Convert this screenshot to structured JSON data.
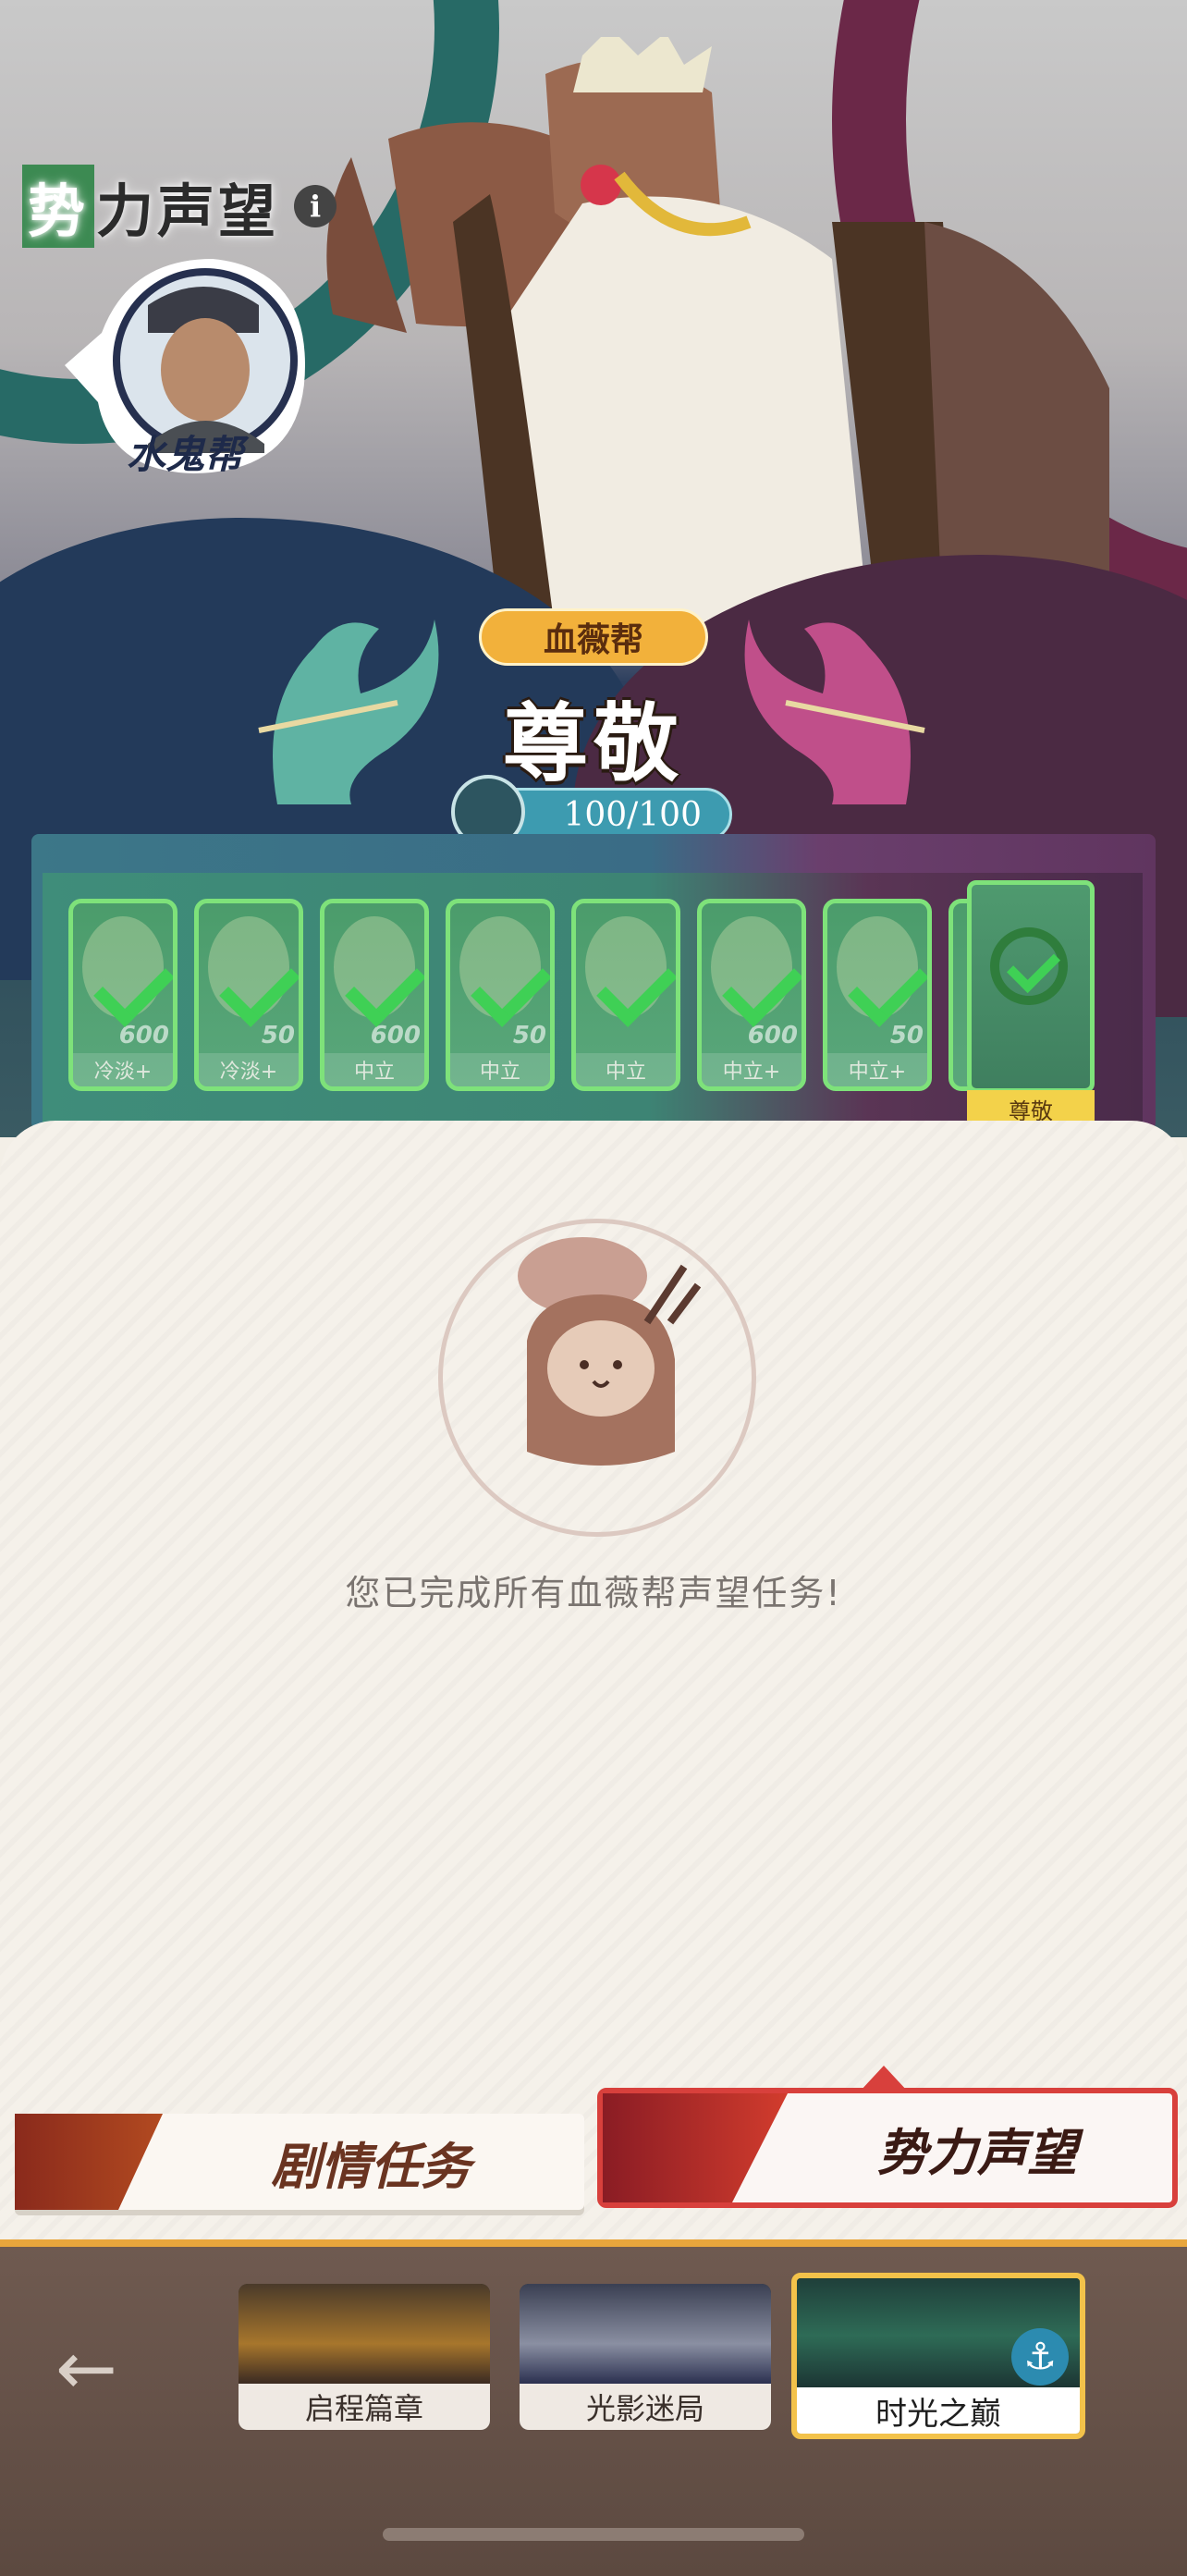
{
  "header": {
    "title": "势力声望",
    "info_icon": "i",
    "faction_name": "水鬼帮"
  },
  "reputation": {
    "gang_name": "血薇帮",
    "rank": "尊敬",
    "progress_text": "100/100",
    "progress": 1.0
  },
  "rewards": [
    {
      "label": "冷淡+",
      "amount": "600",
      "completed": true
    },
    {
      "label": "冷淡+",
      "amount": "50",
      "completed": true
    },
    {
      "label": "中立",
      "amount": "600",
      "completed": true
    },
    {
      "label": "中立",
      "amount": "50",
      "completed": true
    },
    {
      "label": "中立",
      "amount": "",
      "completed": true
    },
    {
      "label": "中立+",
      "amount": "600",
      "completed": true
    },
    {
      "label": "中立+",
      "amount": "50",
      "completed": true
    }
  ],
  "final_reward": {
    "label": "尊敬",
    "completed": true
  },
  "panel": {
    "message": "您已完成所有血薇帮声望任务!"
  },
  "tabs": {
    "story": "剧情任务",
    "reputation": "势力声望"
  },
  "chapters": [
    {
      "name": "启程篇章",
      "active": false
    },
    {
      "name": "光影迷局",
      "active": false
    },
    {
      "name": "时光之巅",
      "active": true
    }
  ],
  "colors": {
    "accent_red": "#d8403c",
    "check_green": "#3fd055",
    "gold": "#f3c24a"
  }
}
